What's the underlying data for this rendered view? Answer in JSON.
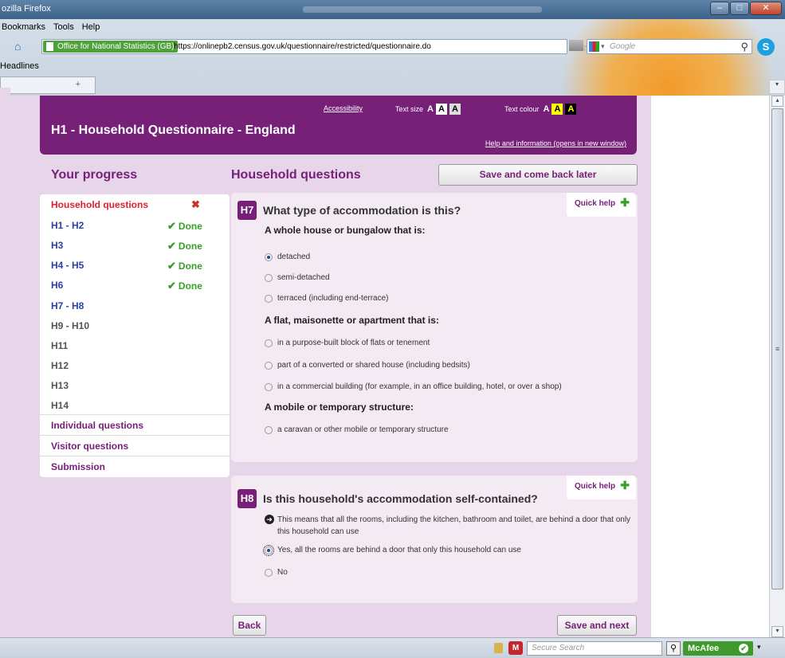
{
  "window": {
    "title": "ozilla Firefox",
    "min": "–",
    "max": "□",
    "close": "✕"
  },
  "menu": [
    "Bookmarks",
    "Tools",
    "Help"
  ],
  "nav": {
    "site_identity": "Office for National Statistics (GB)",
    "url": "https://onlinepb2.census.gov.uk/questionnaire/restricted/questionnaire.do",
    "search_placeholder": "Google"
  },
  "bookmarks": {
    "label": "Headlines"
  },
  "tab": {
    "plus": "+"
  },
  "header": {
    "accessibility": "Accessibility",
    "text_size_label": "Text size",
    "text_colour_label": "Text colour",
    "btn_a": "A",
    "title": "H1 - Household Questionnaire - England",
    "help_link": "Help and information (opens in new window)"
  },
  "progress": {
    "title": "Your progress",
    "current": "Household questions",
    "items": [
      {
        "label": "H1 - H2",
        "done": "Done"
      },
      {
        "label": "H3",
        "done": "Done"
      },
      {
        "label": "H4 - H5",
        "done": "Done"
      },
      {
        "label": "H6",
        "done": "Done"
      },
      {
        "label": "H7 - H8"
      },
      {
        "label": "H9 - H10"
      },
      {
        "label": "H11"
      },
      {
        "label": "H12"
      },
      {
        "label": "H13"
      },
      {
        "label": "H14"
      }
    ],
    "sections": [
      "Individual questions",
      "Visitor questions",
      "Submission"
    ]
  },
  "main": {
    "title": "Household questions",
    "save_later": "Save and come back later",
    "quick_help": "Quick help",
    "q7": {
      "num": "H7",
      "text": "What type of accommodation is this?",
      "group1": "A whole house or bungalow that is:",
      "group1_opts": [
        "detached",
        "semi-detached",
        "terraced (including end-terrace)"
      ],
      "group2": "A flat, maisonette or apartment that is:",
      "group2_opts": [
        "in a purpose-built block of flats or tenement",
        "part of a converted or shared house (including bedsits)",
        "in a commercial building (for example, in an office building, hotel, or over a shop)"
      ],
      "group3": "A mobile or temporary structure:",
      "group3_opts": [
        "a caravan or other mobile or temporary structure"
      ],
      "selected": "detached"
    },
    "q8": {
      "num": "H8",
      "text": "Is this household's accommodation self-contained?",
      "note": "This means that all the rooms, including the kitchen, bathroom and toilet, are behind a door that only this household can use",
      "opts": [
        "Yes, all the rooms are behind a door that only this household can use",
        "No"
      ],
      "selected": "Yes, all the rooms are behind a door that only this household can use"
    },
    "back": "Back",
    "save_next": "Save and next"
  },
  "statusbar": {
    "search_placeholder": "Secure Search",
    "mcafee": "McAfee",
    "mcafee_shield": "M"
  },
  "colors": {
    "brand_purple": "#762078",
    "done_green": "#3a9d2c",
    "current_red": "#e0202a",
    "link_blue": "#2a3fa8"
  }
}
